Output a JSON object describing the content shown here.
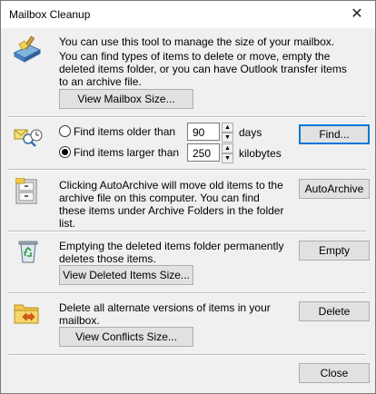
{
  "window": {
    "title": "Mailbox Cleanup",
    "close_icon": "close-icon"
  },
  "intro": {
    "line1": "You can use this tool to manage the size of your mailbox.",
    "line2": "You can find types of items to delete or move, empty the deleted items folder, or you can have Outlook transfer items to an archive file.",
    "view_size_label": "View Mailbox Size..."
  },
  "find": {
    "older_label": "Find items older than",
    "older_value": "90",
    "older_unit": "days",
    "larger_label": "Find items larger than",
    "larger_value": "250",
    "larger_unit": "kilobytes",
    "selected": "larger",
    "find_label": "Find..."
  },
  "archive": {
    "text": "Clicking AutoArchive will move old items to the archive file on this computer. You can find these items under Archive Folders in the folder list.",
    "button_label": "AutoArchive"
  },
  "deleted": {
    "text": "Emptying the deleted items folder permanently deletes those items.",
    "empty_label": "Empty",
    "view_label": "View Deleted Items Size..."
  },
  "conflicts": {
    "text": "Delete all alternate versions of items in your mailbox.",
    "delete_label": "Delete",
    "view_label": "View Conflicts Size..."
  },
  "footer": {
    "close_label": "Close"
  }
}
